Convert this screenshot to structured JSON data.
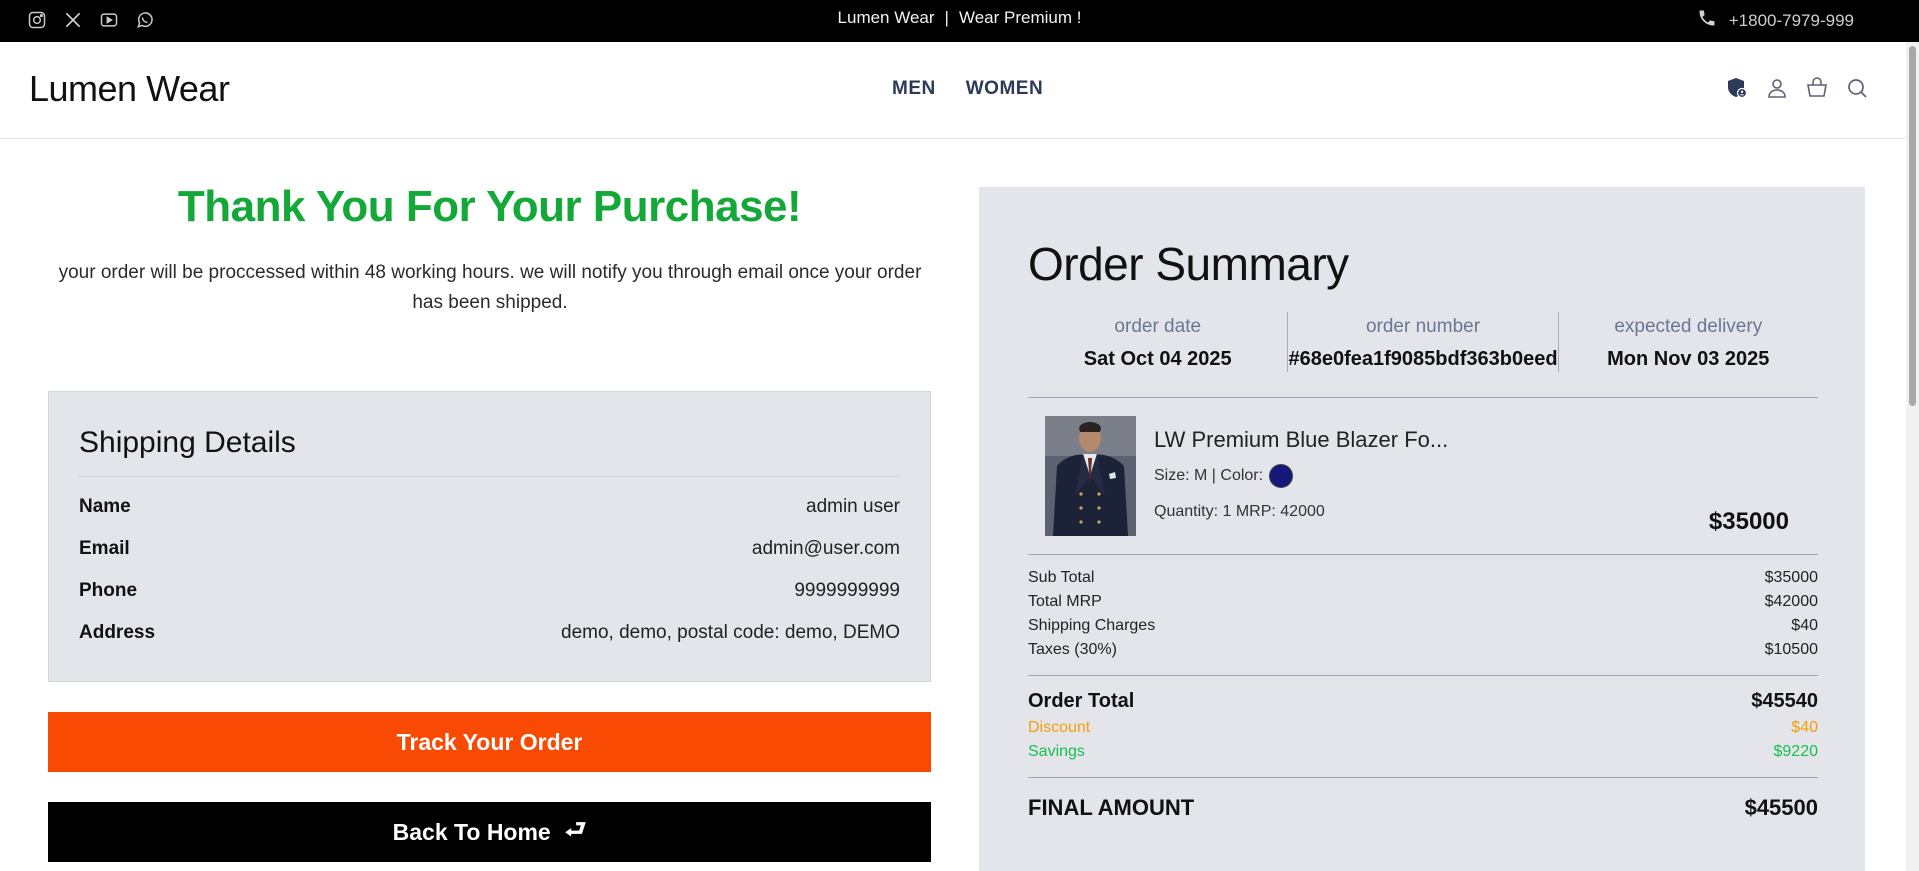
{
  "topbar": {
    "socials": [
      "instagram-icon",
      "x-icon",
      "youtube-icon",
      "whatsapp-icon"
    ],
    "promo_left": "Lumen Wear",
    "promo_sep": "|",
    "promo_right": "Wear Premium !",
    "phone": "+1800-7979-999"
  },
  "header": {
    "logo": "Lumen Wear",
    "nav": [
      "MEN",
      "WOMEN"
    ],
    "icons": [
      "shield-user-icon",
      "user-icon",
      "bag-icon",
      "search-icon"
    ]
  },
  "confirmation": {
    "title": "Thank You For Your Purchase!",
    "note": "your order will be proccessed within 48 working hours. we will notify you through email once your order has been shipped."
  },
  "shipping": {
    "title": "Shipping Details",
    "rows": [
      {
        "label": "Name",
        "value": "admin user"
      },
      {
        "label": "Email",
        "value": "admin@user.com"
      },
      {
        "label": "Phone",
        "value": "9999999999"
      },
      {
        "label": "Address",
        "value": "demo, demo, postal code: demo, DEMO"
      }
    ]
  },
  "buttons": {
    "track": "Track Your Order",
    "home": "Back To Home",
    "home_arrow": "⮐"
  },
  "summary": {
    "title": "Order Summary",
    "meta": [
      {
        "label": "order date",
        "value": "Sat Oct 04 2025"
      },
      {
        "label": "order number",
        "value": "#68e0fea1f9085bdf363b0eed"
      },
      {
        "label": "expected delivery",
        "value": "Mon Nov 03 2025"
      }
    ],
    "item": {
      "name": "LW Premium Blue Blazer Fo...",
      "attrs": "Size: M | Color:",
      "color": "#15197a",
      "qty": "Quantity: 1 MRP: 42000",
      "price": "$35000"
    },
    "totals": [
      {
        "label": "Sub Total",
        "value": "$35000"
      },
      {
        "label": "Total MRP",
        "value": "$42000"
      },
      {
        "label": "Shipping Charges",
        "value": "$40"
      },
      {
        "label": "Taxes (30%)",
        "value": "$10500"
      }
    ],
    "order_total": {
      "label": "Order Total",
      "value": "$45540"
    },
    "discount": {
      "label": "Discount",
      "value": "$40"
    },
    "savings": {
      "label": "Savings",
      "value": "$9220"
    },
    "final": {
      "label": "FINAL AMOUNT",
      "value": "$45500"
    }
  },
  "colors": {
    "accent_green": "#13a838",
    "accent_orange": "#f84a03",
    "discount": "#f59e0b",
    "savings": "#16c050"
  }
}
